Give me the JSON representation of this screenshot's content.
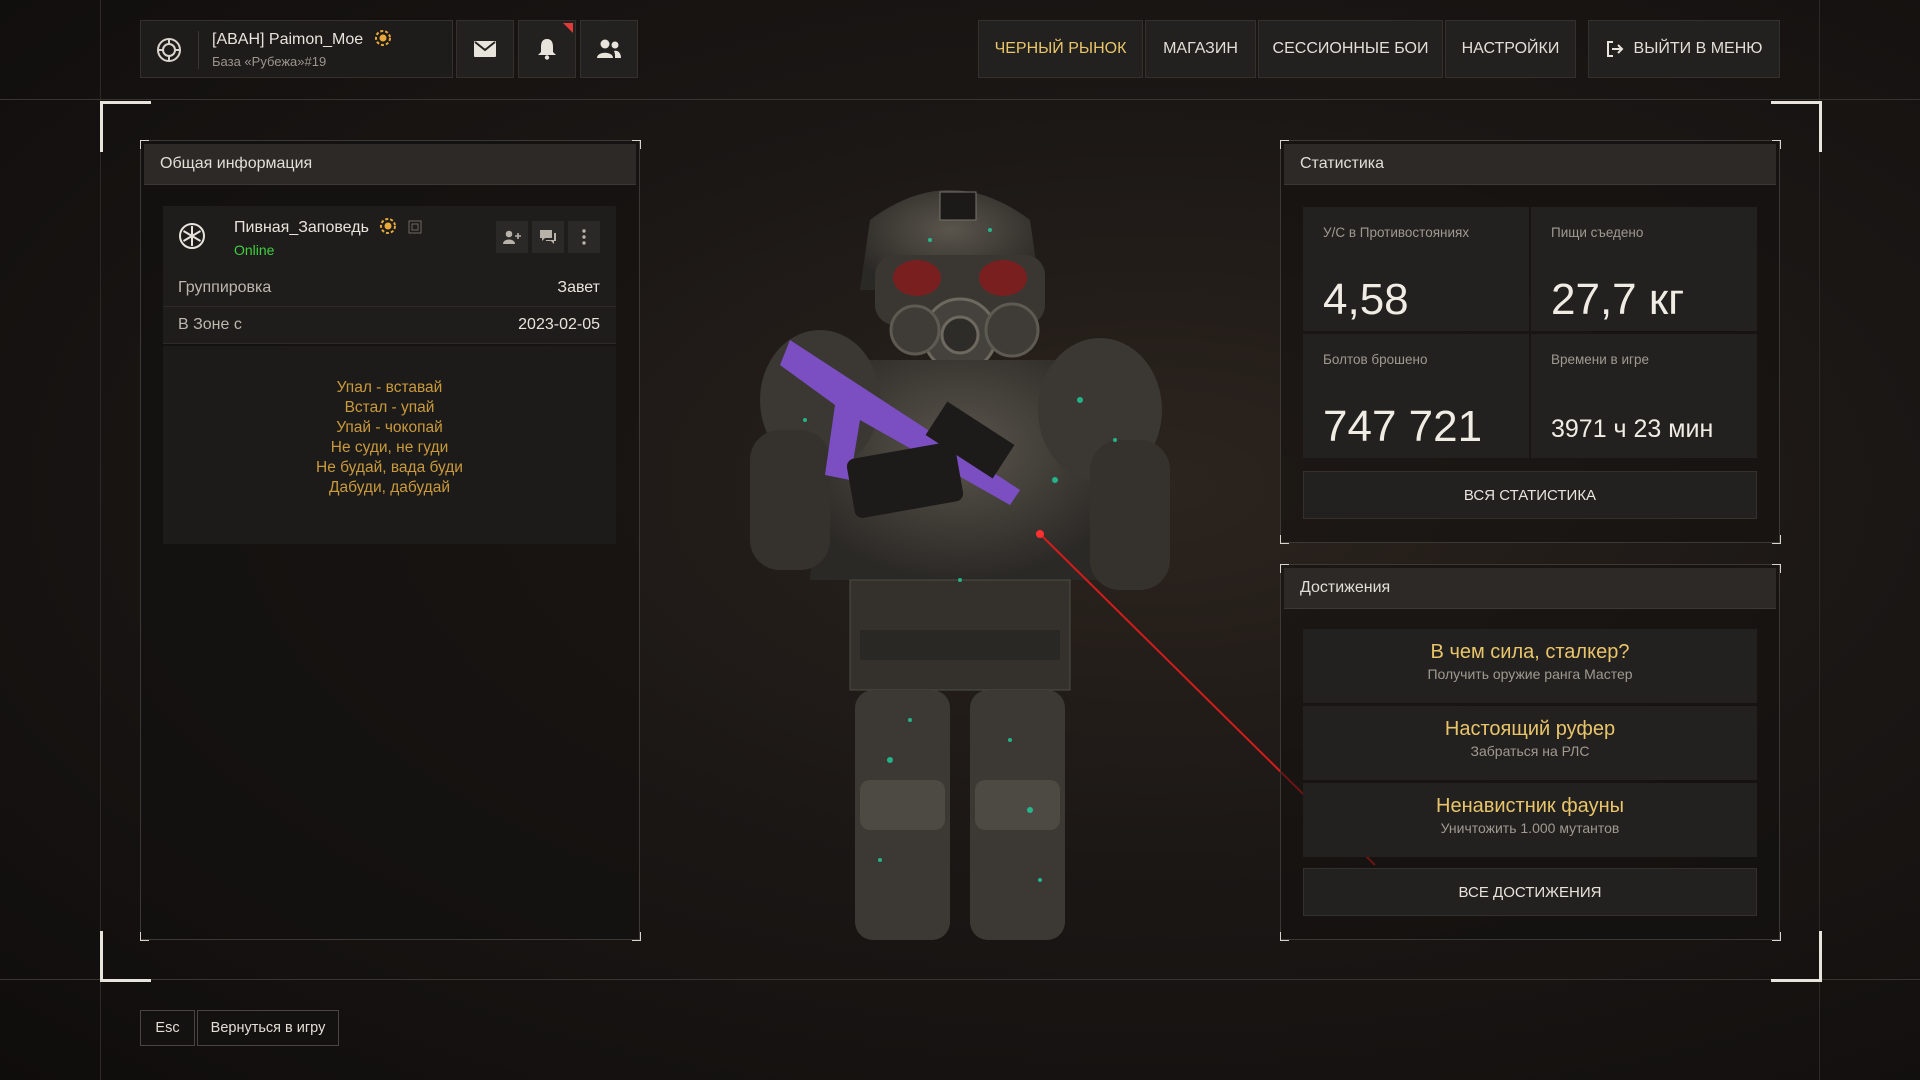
{
  "header": {
    "user_name": "[ABAH] Paimon_Moe",
    "user_base": "База «Рубежа»#19",
    "nav": [
      {
        "label": "ЧЕРНЫЙ РЫНОК"
      },
      {
        "label": "МАГАЗИН"
      },
      {
        "label": "СЕССИОННЫЕ БОИ"
      },
      {
        "label": "НАСТРОЙКИ"
      }
    ],
    "exit_label": "ВЫЙТИ В МЕНЮ"
  },
  "general": {
    "title": "Общая информация",
    "player_name": "Пивная_Заповедь",
    "status": "Online",
    "rows": [
      {
        "key": "Группировка",
        "value": "Завет"
      },
      {
        "key": "В Зоне с",
        "value": "2023-02-05"
      }
    ],
    "motto": [
      "Упал - вставай",
      "Встал - упай",
      "Упай - чокопай",
      "Не суди, не гуди",
      "Не будай, вада буди",
      "Дабуди, дабудай"
    ]
  },
  "stats": {
    "title": "Статистика",
    "items": [
      {
        "label": "У/С в Противостояниях",
        "value": "4,58"
      },
      {
        "label": "Пищи съедено",
        "value": "27,7 кг"
      },
      {
        "label": "Болтов брошено",
        "value": "747 721"
      },
      {
        "label": "Времени в игре",
        "value": "3971 ч 23 мин"
      }
    ],
    "all_label": "ВСЯ СТАТИСТИКА"
  },
  "achievements": {
    "title": "Достижения",
    "items": [
      {
        "title": "В чем сила, сталкер?",
        "desc": "Получить оружие ранга Мастер"
      },
      {
        "title": "Настоящий руфер",
        "desc": "Забраться на РЛС"
      },
      {
        "title": "Ненавистник фауны",
        "desc": "Уничтожить 1.000 мутантов"
      }
    ],
    "all_label": "ВСЕ ДОСТИЖЕНИЯ"
  },
  "footer": {
    "key_label": "Esc",
    "action_label": "Вернуться в игру"
  },
  "colors": {
    "accent_gold": "#e9c56a",
    "motto_orange": "#c99a3c",
    "online_green": "#3fcf3f",
    "notify_red": "#e03a3a"
  }
}
